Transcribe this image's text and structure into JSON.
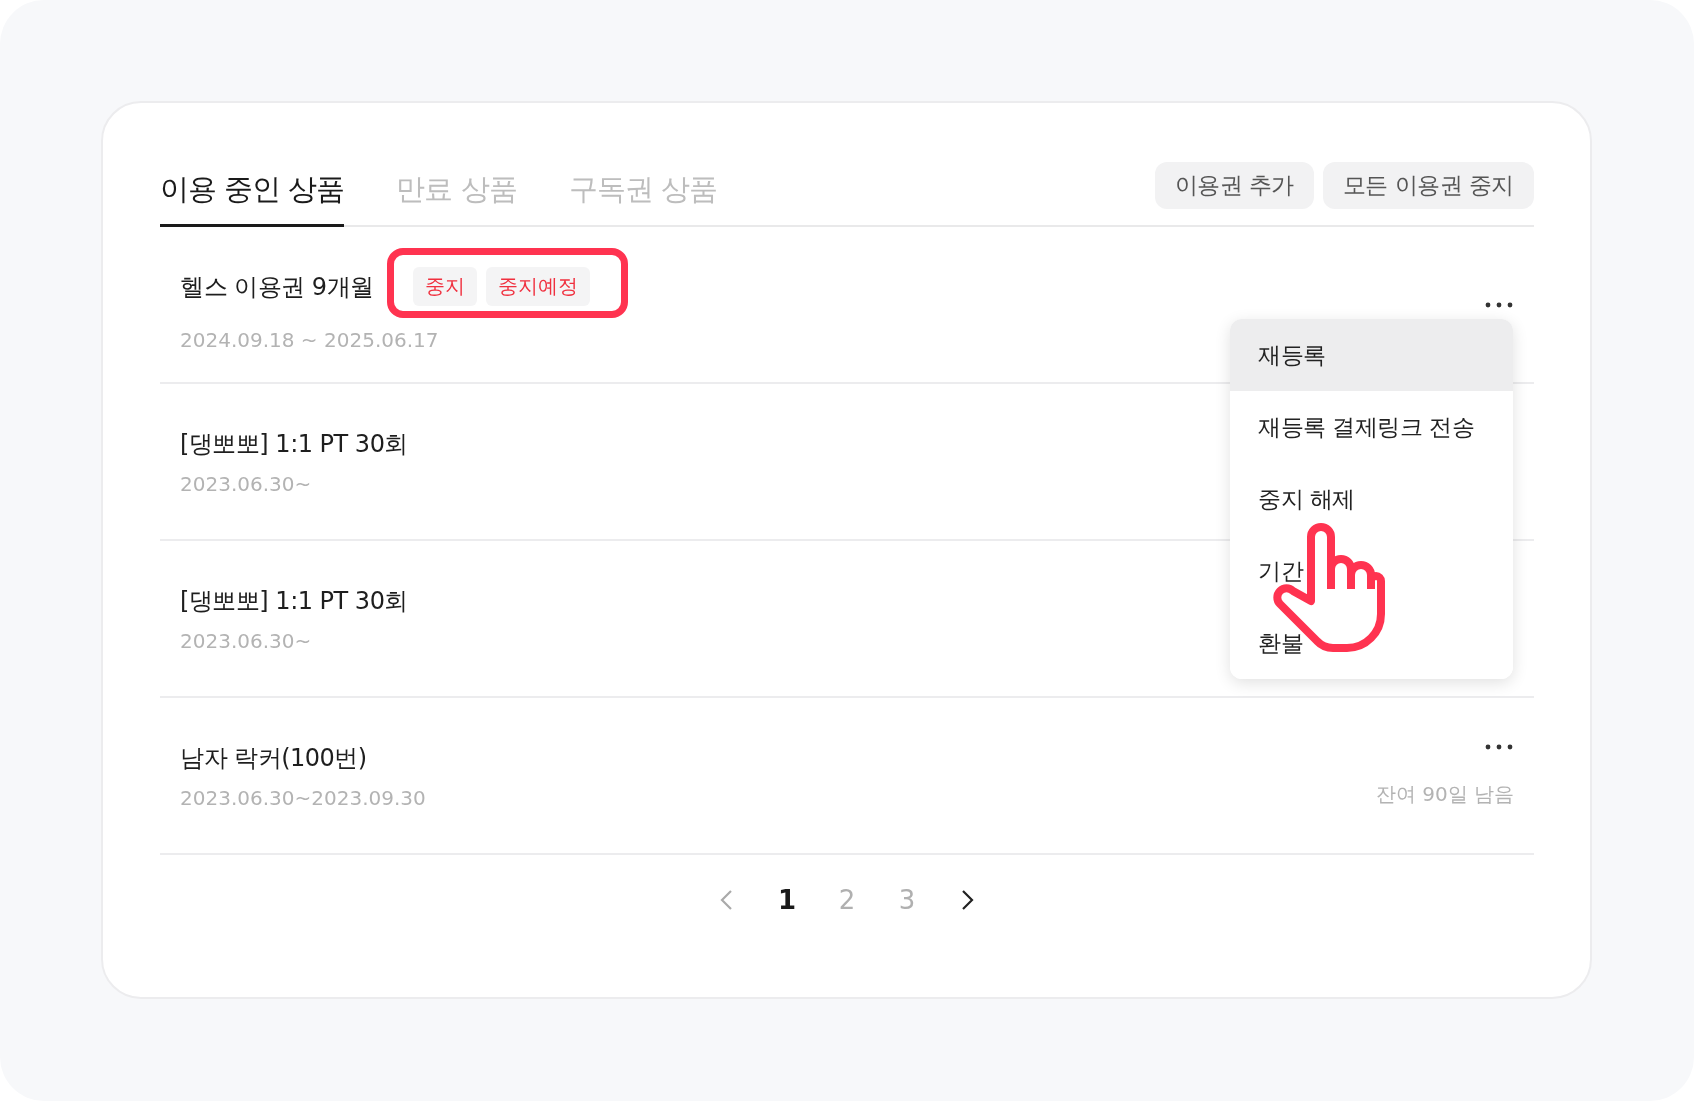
{
  "tabs": [
    {
      "label": "이용 중인 상품",
      "selected": true
    },
    {
      "label": "만료 상품",
      "selected": false
    },
    {
      "label": "구독권 상품",
      "selected": false
    }
  ],
  "actions": [
    "이용권 추가",
    "모든 이용권 중지"
  ],
  "products": [
    {
      "name": "헬스 이용권 9개월",
      "period": "2024.09.18 ~ 2025.06.17",
      "tags": [
        "중지",
        "중지예정"
      ],
      "more_button": true
    },
    {
      "name": "[댕뽀뽀] 1:1 PT 30회",
      "period": "2023.06.30~",
      "more_button": false
    },
    {
      "name": "[댕뽀뽀] 1:1 PT 30회",
      "period": "2023.06.30~",
      "more_button": false
    },
    {
      "name": "남자 락커(100번)",
      "period": "2023.06.30~2023.09.30",
      "remaining": "잔여 90일 남음",
      "more_button": true
    }
  ],
  "context_menu": {
    "items": [
      {
        "label": "재등록",
        "selected": true
      },
      {
        "label": "재등록 결제링크 전송",
        "selected": false
      },
      {
        "label": "중지 해제",
        "selected": false
      },
      {
        "label": "기간",
        "selected": false
      },
      {
        "label": "환불",
        "selected": false
      }
    ]
  },
  "pagination": {
    "pages": [
      {
        "label": "1",
        "selected": true
      },
      {
        "label": "2",
        "selected": false
      },
      {
        "label": "3",
        "selected": false
      }
    ]
  }
}
